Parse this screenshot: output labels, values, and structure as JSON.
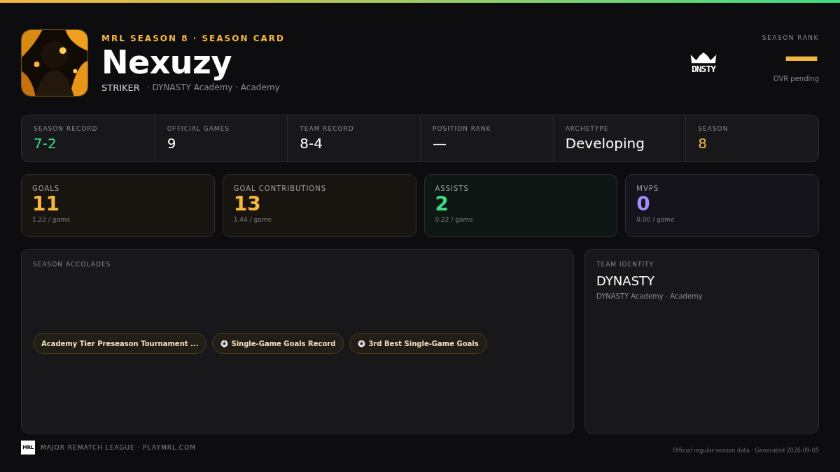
{
  "header": {
    "eyebrow": "MRL SEASON 8 · SEASON CARD",
    "player_name": "Nexuzy",
    "position": "STRIKER",
    "team_line": "· DYNASTY Academy · Academy",
    "team_logo_text": "DNSTY"
  },
  "season_rank": {
    "label": "SEASON RANK",
    "value": "—",
    "note": "OVR pending"
  },
  "summary": [
    {
      "label": "SEASON RECORD",
      "value": "7-2",
      "color": "#3ddc84"
    },
    {
      "label": "OFFICIAL GAMES",
      "value": "9",
      "color": "#ffffff"
    },
    {
      "label": "TEAM RECORD",
      "value": "8-4",
      "color": "#ffffff"
    },
    {
      "label": "POSITION RANK",
      "value": "—",
      "color": "#ffffff"
    },
    {
      "label": "ARCHETYPE",
      "value": "Developing",
      "color": "#ffffff"
    },
    {
      "label": "SEASON",
      "value": "8",
      "color": "#f5b83d"
    }
  ],
  "stats": [
    {
      "label": "GOALS",
      "value": "11",
      "per_game": "1.22 / game",
      "color": "#f5b83d"
    },
    {
      "label": "GOAL CONTRIBUTIONS",
      "value": "13",
      "per_game": "1.44 / game",
      "color": "#f5b83d"
    },
    {
      "label": "ASSISTS",
      "value": "2",
      "per_game": "0.22 / game",
      "color": "#3ddc84"
    },
    {
      "label": "MVPS",
      "value": "0",
      "per_game": "0.00 / game",
      "color": "#a78bfa"
    }
  ],
  "accolades": {
    "title": "SEASON ACCOLADES",
    "chips": [
      {
        "label": "Academy Tier Preseason Tournament ...",
        "kind": "plain"
      },
      {
        "label": "Single-Game Goals Record",
        "kind": "ball"
      },
      {
        "label": "3rd Best Single-Game Goals",
        "kind": "ball"
      }
    ]
  },
  "team_identity": {
    "title": "TEAM IDENTITY",
    "name": "DYNASTY",
    "subtitle": "DYNASTY Academy · Academy"
  },
  "footer": {
    "logo_text": "MRL",
    "league": "MAJOR REMATCH LEAGUE · PLAYMRL.COM",
    "note": "Official regular-season data · Generated 2026-09-05"
  }
}
